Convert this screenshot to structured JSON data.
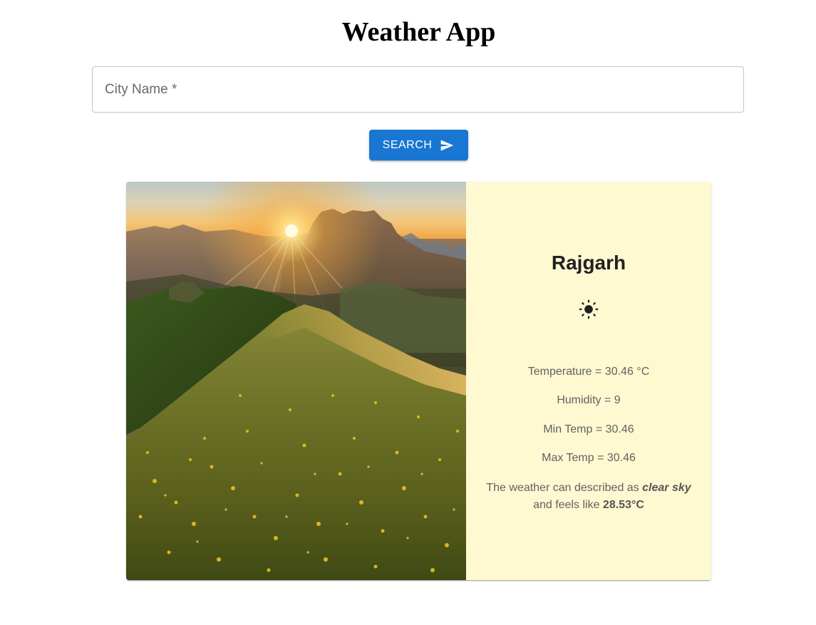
{
  "app": {
    "title": "Weather App"
  },
  "search": {
    "label": "City Name *",
    "value": "",
    "button_label": "SEARCH",
    "button_icon": "send-icon"
  },
  "card": {
    "image_alt": "Sunrise over a grassy mountain ridge",
    "city": "Rajgarh",
    "weather_icon": "sun-icon",
    "temperature_text": "Temperature = 30.46 °C",
    "humidity_text": "Humidity = 9",
    "min_temp_text": "Min Temp = 30.46",
    "max_temp_text": "Max Temp = 30.46",
    "description_prefix": "The weather can described as",
    "description": "clear sky",
    "feels_like_prefix": "and feels like",
    "feels_like": "28.53°C"
  },
  "colors": {
    "primary": "#1976d2",
    "info_background": "#fff9d1",
    "text_secondary": "#616161"
  }
}
